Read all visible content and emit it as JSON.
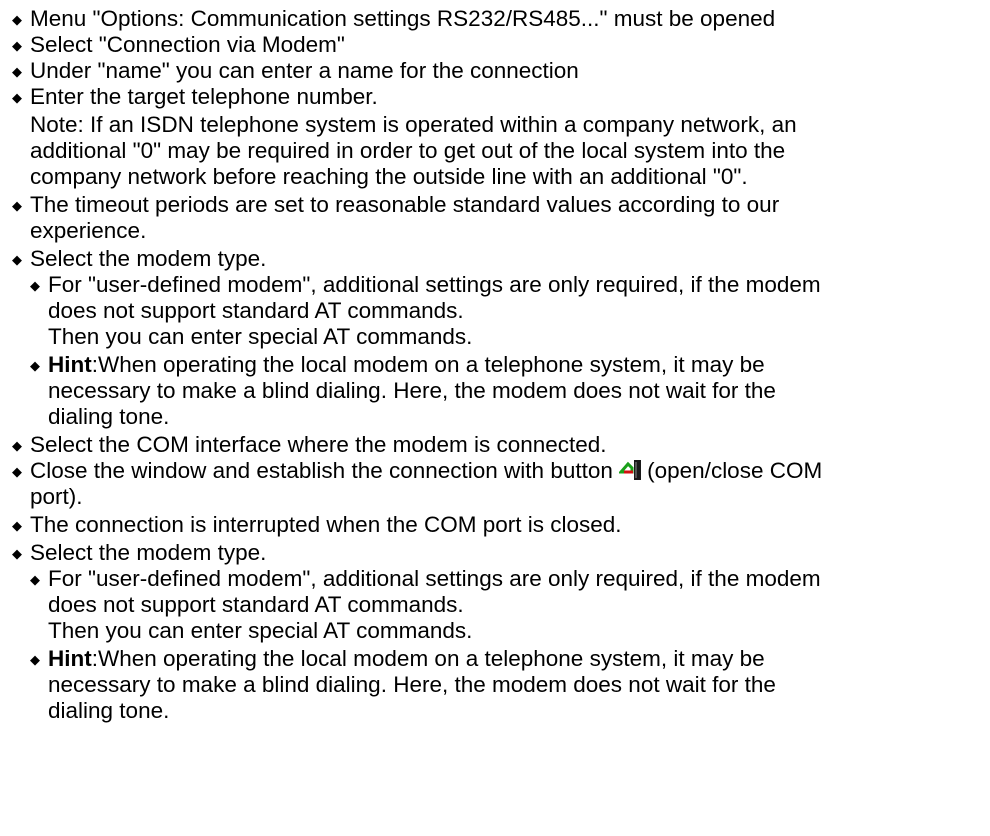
{
  "bullet_glyph": "◆",
  "items": [
    {
      "text": "Menu \"Options: Communication settings RS232/RS485...\" must be opened"
    },
    {
      "text": "Select \"Connection via Modem\""
    },
    {
      "text": "Under \"name\" you can enter a name for the connection"
    },
    {
      "text": "Enter the target telephone number.",
      "note": [
        "Note: If an ISDN telephone system is operated within a company network, an",
        "additional \"0\" may be required in order to get out of the local system into the",
        "company network before reaching the outside line with an additional \"0\"."
      ]
    },
    {
      "lines": [
        "The timeout periods are set to reasonable standard values according to our",
        "experience."
      ]
    },
    {
      "text": "Select the modem type."
    },
    {
      "sub_user_defined": [
        "For \"user-defined modem\", additional settings are only required, if the modem",
        "does not support standard AT commands.",
        "Then you can enter special AT commands."
      ]
    },
    {
      "hint": {
        "label": "Hint",
        "lines": [
          ":When operating the local modem on a telephone system, it may be",
          "necessary to make a blind dialing. Here, the modem does not wait for the",
          "dialing tone."
        ]
      }
    },
    {
      "text": "Select the COM interface where the modem is connected."
    },
    {
      "close_window": {
        "before": "Close the window and establish the connection with button",
        "icon": "open-close-com-port-icon",
        "after": "(open/close COM",
        "cont": "port)."
      }
    },
    {
      "text": "The connection is interrupted when the COM port is closed."
    },
    {
      "text": "Select the modem type."
    },
    {
      "sub_user_defined": [
        "For \"user-defined modem\", additional settings are only required, if the modem",
        "does not support standard AT commands.",
        "Then you can enter special AT commands."
      ]
    },
    {
      "hint": {
        "label": "Hint",
        "lines": [
          ":When operating the local modem on a telephone system, it may be",
          "necessary to make a blind dialing. Here, the modem does not wait for the",
          "dialing tone."
        ]
      }
    }
  ]
}
